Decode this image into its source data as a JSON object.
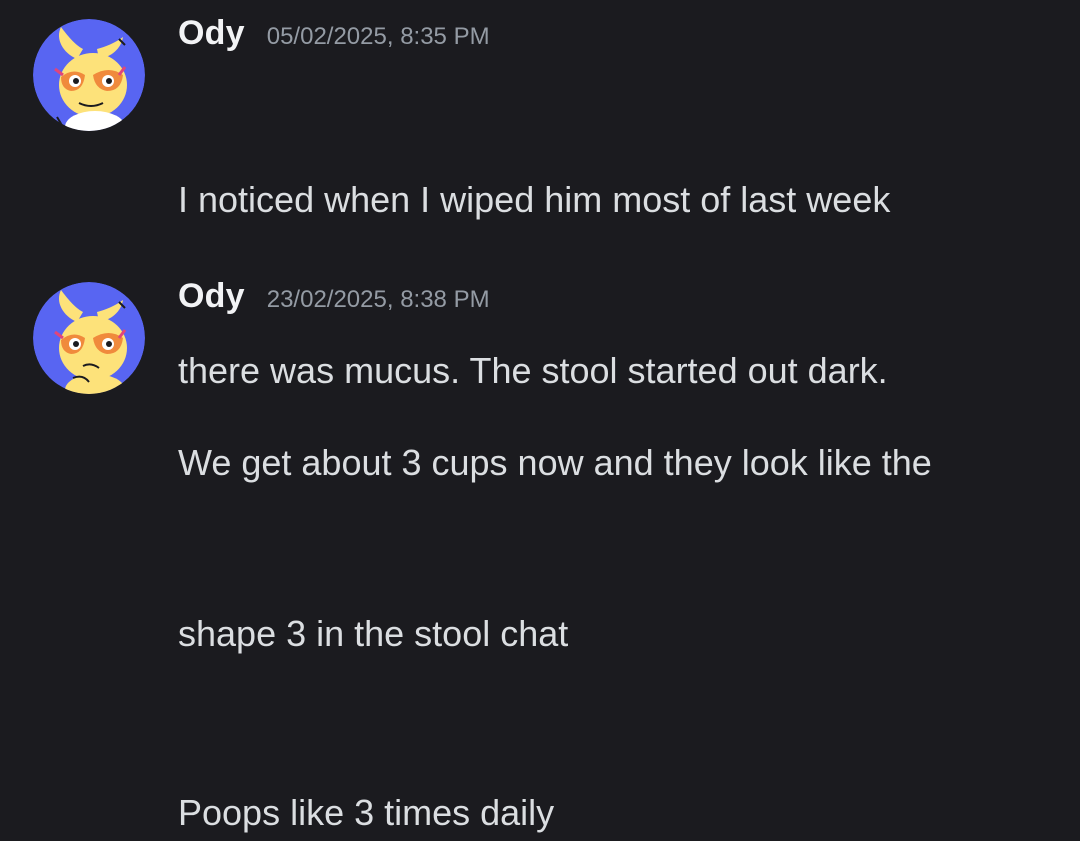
{
  "messages": [
    {
      "username": "Ody",
      "timestamp": "05/02/2025, 8:35 PM",
      "avatar_icon": "bunny-glasses-avatar-icon",
      "lines": [
        "I noticed when I wiped him most of last week",
        "there was mucus. The stool started out dark."
      ]
    },
    {
      "username": "Ody",
      "timestamp": "23/02/2025, 8:38 PM",
      "avatar_icon": "bunny-glasses-avatar-icon",
      "lines": [
        "We get about 3 cups now and they look like the",
        "shape 3 in the stool chat"
      ],
      "followup": "Poops like 3 times daily"
    }
  ],
  "colors": {
    "background": "#1b1b1f",
    "username": "#f2f3f5",
    "timestamp": "#949ba4",
    "text": "#dbdee1",
    "avatar_bg": "#5865f2",
    "avatar_character": "#fde27a",
    "avatar_glasses": "#f08a3c"
  }
}
